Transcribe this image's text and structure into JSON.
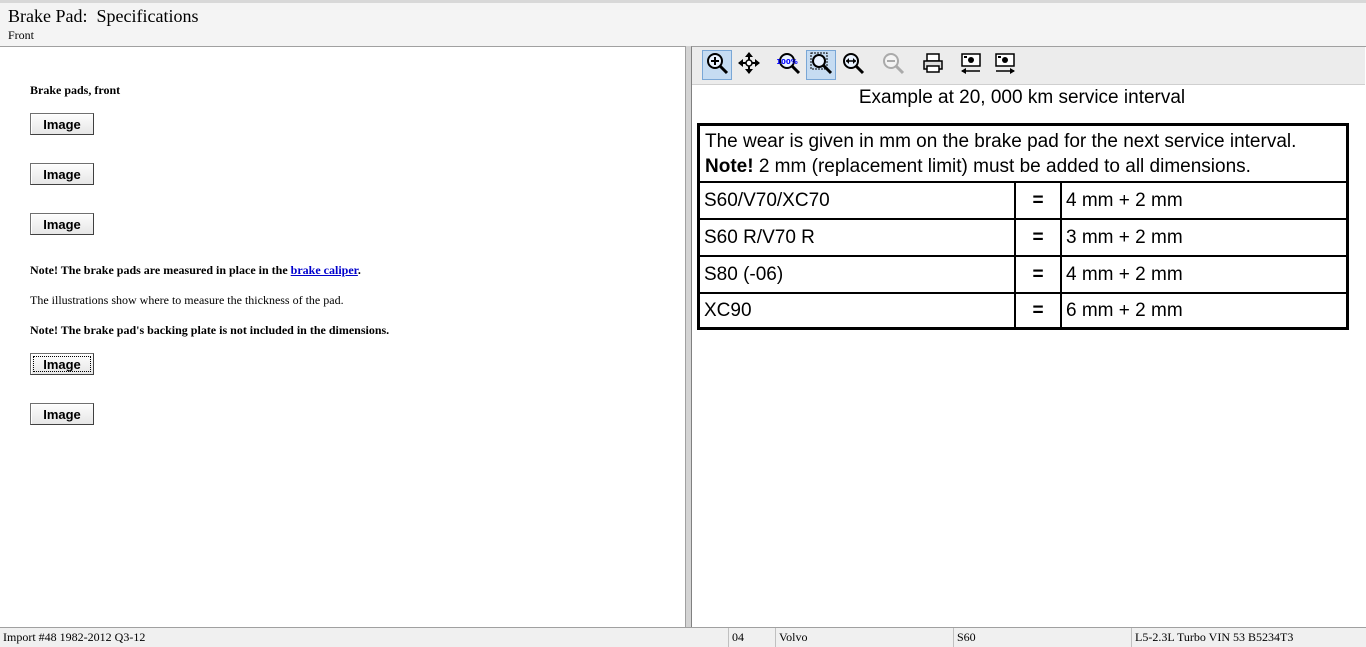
{
  "header": {
    "title": "Brake Pad:  Specifications",
    "subtitle": "Front"
  },
  "left": {
    "heading": "Brake pads, front",
    "image_buttons": [
      "Image",
      "Image",
      "Image",
      "Image",
      "Image"
    ],
    "note1_prefix": "Note! The brake pads are measured in place in the ",
    "note1_link": "brake caliper",
    "note1_suffix": ".",
    "text2": "The illustrations show where to measure the thickness of the pad.",
    "note3": "Note! The brake pad's backing plate is not included in the dimensions."
  },
  "toolbar": {
    "buttons": [
      {
        "icon": "zoom-in-icon",
        "active": true
      },
      {
        "icon": "pan-icon",
        "active": false
      },
      {
        "icon": "zoom-100-icon",
        "active": false
      },
      {
        "icon": "zoom-fit-icon",
        "active": true
      },
      {
        "icon": "zoom-width-icon",
        "active": false
      },
      {
        "icon": "zoom-out-icon",
        "active": false,
        "disabled": true
      },
      {
        "icon": "print-icon",
        "active": false
      },
      {
        "icon": "previous-image-icon",
        "active": false
      },
      {
        "icon": "next-image-icon",
        "active": false
      }
    ]
  },
  "doc": {
    "caption": "Example at 20, 000 km service interval",
    "intro_line1": "The wear is given in mm on the brake pad for the next service interval.",
    "intro_note_label": "Note!",
    "intro_note_text": " 2 mm (replacement limit) must be added to all dimensions.",
    "rows": [
      {
        "model": "S60/V70/XC70",
        "eq": "=",
        "value": "4 mm + 2 mm"
      },
      {
        "model": "S60 R/V70 R",
        "eq": "=",
        "value": "3 mm + 2 mm"
      },
      {
        "model": "S80 (-06)",
        "eq": "=",
        "value": "4 mm + 2 mm"
      },
      {
        "model": "XC90",
        "eq": "=",
        "value": "6 mm + 2 mm"
      }
    ]
  },
  "status": {
    "import": "Import #48 1982-2012 Q3-12",
    "year": "04",
    "make": "Volvo",
    "model": "S60",
    "engine": "L5-2.3L Turbo VIN 53 B5234T3"
  }
}
